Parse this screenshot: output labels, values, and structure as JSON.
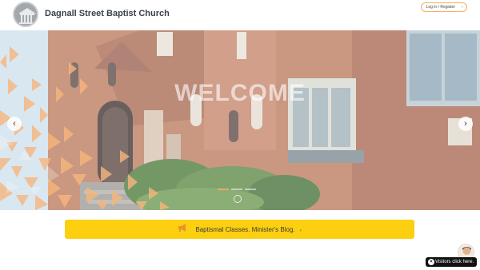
{
  "header": {
    "site_title": "Dagnall Street Baptist Church",
    "login_label": "Log in / Register"
  },
  "hero": {
    "welcome": "WELCOME",
    "prev_icon": "‹",
    "next_icon": "›",
    "slides": 3,
    "active_slide": 0
  },
  "banner": {
    "text": "Baptismal Classes. Minister's Blog.",
    "chevron": "›"
  },
  "visitor": {
    "label": "Visitors click here.",
    "close": "×"
  },
  "colors": {
    "accent": "#f4a259",
    "banner": "#fccf11",
    "brick": "#b97559"
  }
}
